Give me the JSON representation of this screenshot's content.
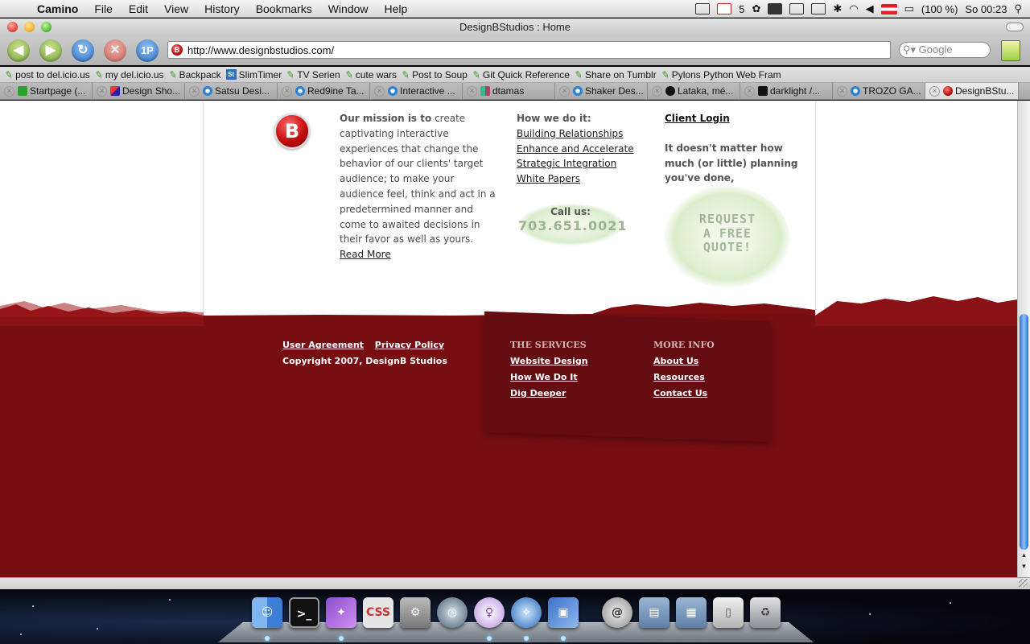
{
  "menubar": {
    "app": "Camino",
    "menus": [
      "File",
      "Edit",
      "View",
      "History",
      "Bookmarks",
      "Window",
      "Help"
    ],
    "gmail_count": "5",
    "battery": "(100 %)",
    "clock": "So 00:23"
  },
  "window": {
    "title": "DesignBStudios : Home"
  },
  "toolbar": {
    "onepassword_label": "1P",
    "url": "http://www.designbstudios.com/",
    "search_placeholder": "Google"
  },
  "bookmarks": [
    {
      "label": "post to del.icio.us",
      "icon": "pencil-icon"
    },
    {
      "label": "my del.icio.us",
      "icon": "pencil-icon"
    },
    {
      "label": "Backpack",
      "icon": "pencil-icon"
    },
    {
      "label": "SlimTimer",
      "icon": "slimtimer-icon"
    },
    {
      "label": "TV Serien",
      "icon": "pencil-icon"
    },
    {
      "label": "cute wars",
      "icon": "pencil-icon"
    },
    {
      "label": "Post to Soup",
      "icon": "pencil-icon"
    },
    {
      "label": "Git Quick Reference",
      "icon": "pencil-icon"
    },
    {
      "label": "Share on Tumblr",
      "icon": "pencil-icon"
    },
    {
      "label": "Pylons Python Web Fram",
      "icon": "pencil-icon"
    }
  ],
  "tabs": [
    {
      "label": "Startpage (...",
      "icon": "green"
    },
    {
      "label": "Design Sho...",
      "icon": "red"
    },
    {
      "label": "Satsu Desi...",
      "icon": "blue"
    },
    {
      "label": "Red9ine Ta...",
      "icon": "blue"
    },
    {
      "label": "Interactive ...",
      "icon": "blue"
    },
    {
      "label": "dtamas",
      "icon": "dt"
    },
    {
      "label": "Shaker Des...",
      "icon": "blue"
    },
    {
      "label": "Lataka, mé...",
      "icon": "black"
    },
    {
      "label": "darklight /...",
      "icon": "term"
    },
    {
      "label": "TROZO GA...",
      "icon": "blue"
    },
    {
      "label": "DesignBStu...",
      "icon": "favb",
      "active": true
    }
  ],
  "page": {
    "logo_letter": "B",
    "mission": {
      "lead": "Our mission is to",
      "text": "create captivating interactive experiences that change the behavior of our clients' target audience; to make your audience feel, think and act in a predetermined manner and come to awaited decisions in their favor as well as yours.",
      "read_more": "Read More"
    },
    "how": {
      "heading": "How we do it:",
      "links": [
        "Building Relationships",
        "Enhance and Accelerate",
        "Strategic Integration",
        "White Papers"
      ]
    },
    "call": {
      "label": "Call us:",
      "number": "703.651.0021"
    },
    "client": {
      "login": "Client Login",
      "message": "It doesn't matter how much (or little) planning you've done,"
    },
    "quote": {
      "line1": "REQUEST",
      "line2": "A FREE",
      "line3": "QUOTE!"
    },
    "footer": {
      "user_agreement": "User Agreement",
      "privacy_policy": "Privacy Policy",
      "copyright": "Copyright 2007, DesignB Studios",
      "services_heading": "THE SERVICES",
      "services": [
        "Website Design",
        "How We Do It",
        "Dig Deeper"
      ],
      "more_heading": "MORE INFO",
      "more": [
        "About Us",
        "Resources",
        "Contact Us"
      ]
    }
  },
  "colors": {
    "footer_red": "#760e12",
    "accent_green": "#9ab38e"
  }
}
